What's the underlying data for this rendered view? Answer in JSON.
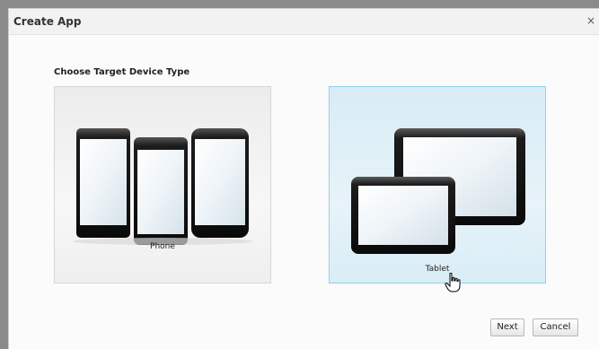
{
  "dialog": {
    "title": "Create App",
    "close_glyph": "×",
    "heading": "Choose Target Device Type"
  },
  "options": [
    {
      "label": "Phone",
      "selected": false,
      "icon": "phones-icon"
    },
    {
      "label": "Tablet",
      "selected": true,
      "icon": "tablets-icon"
    }
  ],
  "buttons": {
    "next": "Next",
    "cancel": "Cancel"
  },
  "colors": {
    "selected_border": "#8fd3ea",
    "selected_background": "#e2f1f8"
  }
}
